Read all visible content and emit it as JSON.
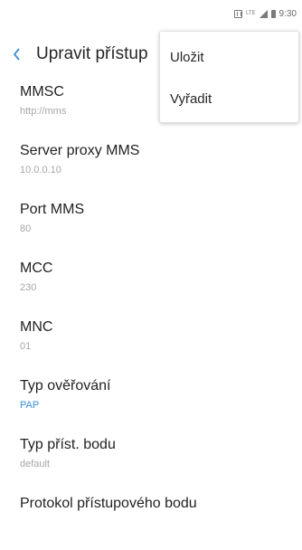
{
  "status_bar": {
    "lte_text": "LTE",
    "time": "9:30",
    "icons": [
      "nfc-icon",
      "lte-icon",
      "signal-icon",
      "battery-icon"
    ]
  },
  "header": {
    "title": "Upravit přístup"
  },
  "settings": [
    {
      "title": "MMSC",
      "value": "http://mms"
    },
    {
      "title": "Server proxy MMS",
      "value": "10.0.0.10"
    },
    {
      "title": "Port MMS",
      "value": "80"
    },
    {
      "title": "MCC",
      "value": "230"
    },
    {
      "title": "MNC",
      "value": "01"
    },
    {
      "title": "Typ ověřování",
      "value": "PAP"
    },
    {
      "title": "Typ příst. bodu",
      "value": "default"
    },
    {
      "title": "Protokol přístupového bodu",
      "value": ""
    }
  ],
  "menu": {
    "items": [
      "Uložit",
      "Vyřadit"
    ]
  },
  "colors": {
    "accent": "#3a8fd6",
    "secondary_text": "#a6a6a6"
  }
}
